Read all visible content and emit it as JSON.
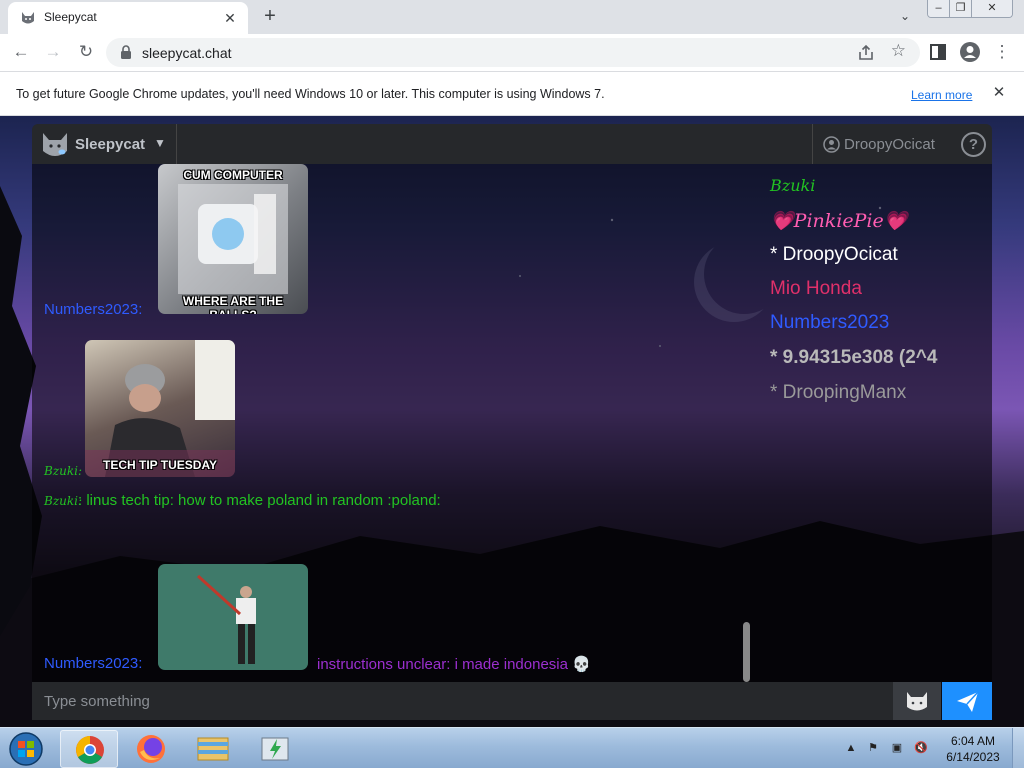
{
  "browser": {
    "tab_title": "Sleepycat",
    "url": "sleepycat.chat",
    "infobar_text": "To get future Google Chrome updates, you'll need Windows 10 or later. This computer is using Windows 7.",
    "infobar_link": "Learn more"
  },
  "app": {
    "brand": "Sleepycat",
    "current_user": "DroopyOcicat",
    "help_label": "?",
    "input_placeholder": "Type something"
  },
  "messages": [
    {
      "author": "Numbers2023:",
      "author_color": "#2f5bff",
      "type": "image",
      "caption_top": "CUM COMPUTER",
      "caption_bottom": "WHERE ARE THE BALLS?"
    },
    {
      "author": "Bzuki:",
      "author_color": "#22c322",
      "type": "image",
      "caption_bottom": "TECH TIP TUESDAY"
    },
    {
      "author": "Bzuki:",
      "author_color": "#22c322",
      "type": "text",
      "text": ": linus tech tip: how to make poland in random :poland:",
      "text_color": "#22c322"
    },
    {
      "author": "Numbers2023:",
      "author_color": "#2f5bff",
      "type": "image_text",
      "text": "instructions unclear: i made indonesia 💀",
      "text_color": "#9b2fcf"
    }
  ],
  "userlist": [
    {
      "name": "Bzuki",
      "color": "#22c322"
    },
    {
      "name": "💗PinkiePie💗",
      "color": "#ff5db1"
    },
    {
      "name": "* DroopyOcicat",
      "color": "#ffffff"
    },
    {
      "name": "Mio Honda",
      "color": "#e0306a"
    },
    {
      "name": "Numbers2023",
      "color": "#2f5bff"
    },
    {
      "name": "* 9.94315e308 (2^4",
      "color": "#b9b9b9"
    },
    {
      "name": "* DroopingManx",
      "color": "#9a9a9a"
    }
  ],
  "taskbar": {
    "time": "6:04 AM",
    "date": "6/14/2023"
  },
  "icons": {
    "favicon": "cat-icon",
    "lock": "lock-icon",
    "send": "send-icon",
    "emoji": "cat-face-icon"
  },
  "colors": {
    "send_button": "#1e90ff",
    "header_bg": "#26282b"
  }
}
